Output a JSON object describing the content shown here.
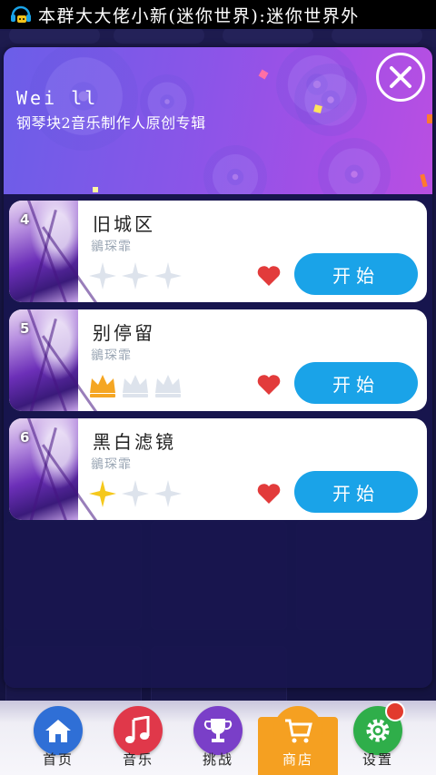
{
  "status_bar": {
    "text": "本群大大佬小新(迷你世界):迷你世界外",
    "icon": "headset-chat-icon"
  },
  "modal": {
    "title": "Wei ll",
    "subtitle": "钢琴块2音乐制作人原创专辑",
    "close_icon": "close-icon",
    "songs": [
      {
        "rank": "4",
        "name": "旧城区",
        "artist": "鶲琛霏",
        "rating": {
          "crowns": 0,
          "stars": 0,
          "max": 3,
          "type": "star"
        },
        "favorite": true,
        "start_label": "开始"
      },
      {
        "rank": "5",
        "name": "别停留",
        "artist": "鶲琛霏",
        "rating": {
          "crowns": 1,
          "max": 3,
          "type": "crown"
        },
        "favorite": true,
        "start_label": "开始"
      },
      {
        "rank": "6",
        "name": "黑白滤镜",
        "artist": "鶲琛霏",
        "rating": {
          "stars": 1,
          "max": 3,
          "type": "star"
        },
        "favorite": true,
        "start_label": "开始"
      }
    ]
  },
  "bottom_nav": {
    "items": [
      {
        "label": "首页",
        "icon": "home-icon",
        "color": "#2f6fd6"
      },
      {
        "label": "音乐",
        "icon": "music-note-icon",
        "color": "#e0384a"
      },
      {
        "label": "挑战",
        "icon": "trophy-icon",
        "color": "#7a3fc8"
      },
      {
        "label": "商店",
        "icon": "cart-icon",
        "color": "#f5a021",
        "active": true
      },
      {
        "label": "设置",
        "icon": "gear-icon",
        "color": "#2fae4a",
        "badge": true
      }
    ]
  },
  "colors": {
    "accent": "#1aa3e8",
    "heart": "#e23b3b",
    "crown_gold": "#f5a623",
    "header_gradient_start": "#6b5ee8",
    "header_gradient_end": "#b94fe2"
  }
}
